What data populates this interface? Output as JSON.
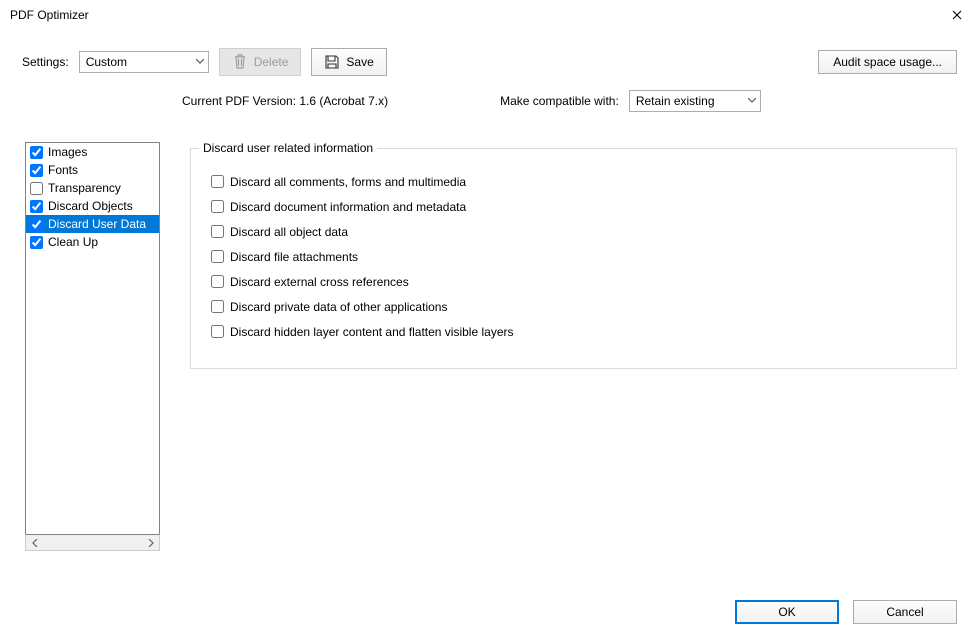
{
  "window": {
    "title": "PDF Optimizer"
  },
  "toolbar": {
    "settings_label": "Settings:",
    "settings_value": "Custom",
    "delete_label": "Delete",
    "save_label": "Save",
    "audit_label": "Audit space usage..."
  },
  "info": {
    "version_label": "Current PDF Version: 1.6 (Acrobat 7.x)",
    "compat_label": "Make compatible with:",
    "compat_value": "Retain existing"
  },
  "categories": [
    {
      "label": "Images",
      "checked": true,
      "selected": false
    },
    {
      "label": "Fonts",
      "checked": true,
      "selected": false
    },
    {
      "label": "Transparency",
      "checked": false,
      "selected": false
    },
    {
      "label": "Discard Objects",
      "checked": true,
      "selected": false
    },
    {
      "label": "Discard User Data",
      "checked": true,
      "selected": true
    },
    {
      "label": "Clean Up",
      "checked": true,
      "selected": false
    }
  ],
  "panel": {
    "legend": "Discard user related information",
    "options": [
      {
        "label": "Discard all comments, forms and multimedia",
        "checked": false
      },
      {
        "label": "Discard document information and metadata",
        "checked": false
      },
      {
        "label": "Discard all object data",
        "checked": false
      },
      {
        "label": "Discard file attachments",
        "checked": false
      },
      {
        "label": "Discard external cross references",
        "checked": false
      },
      {
        "label": "Discard private data of other applications",
        "checked": false
      },
      {
        "label": "Discard hidden layer content and flatten visible layers",
        "checked": false
      }
    ]
  },
  "footer": {
    "ok": "OK",
    "cancel": "Cancel"
  }
}
